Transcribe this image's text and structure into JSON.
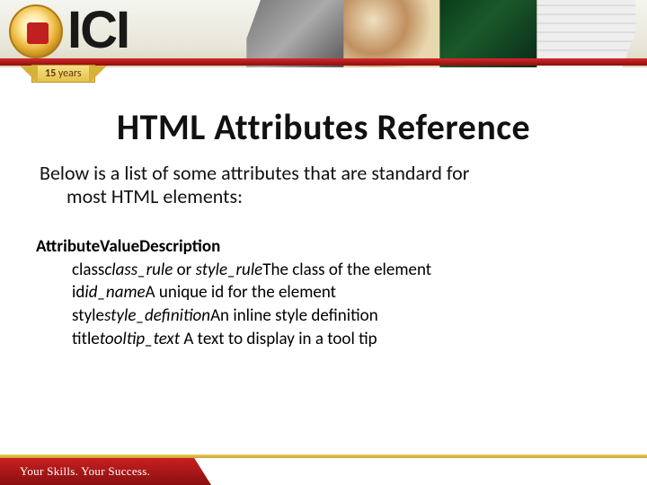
{
  "banner": {
    "logo_text": "ICI",
    "ribbon_number": "15",
    "ribbon_word": "years"
  },
  "title": "HTML Attributes Reference",
  "intro_line1": "Below is a list of some attributes that are standard for",
  "intro_line2": "most HTML elements:",
  "table": {
    "header_attr": "Attribute",
    "header_val": "Value",
    "header_desc": "Description",
    "rows": [
      {
        "attr": "class",
        "val": "class_rule",
        "val_sep": " or ",
        "val2": "style_rule",
        "desc": "The class of the element"
      },
      {
        "attr": "id",
        "val": "id_name",
        "val_sep": "",
        "val2": "",
        "desc": "A unique id for the element"
      },
      {
        "attr": "style",
        "val": "style_definition",
        "val_sep": "",
        "val2": "",
        "desc": "An inline style definition"
      },
      {
        "attr": "title",
        "val": "tooltip_text ",
        "val_sep": "",
        "val2": "",
        "desc": "A text to display in a tool tip"
      }
    ]
  },
  "footer": {
    "tagline": "Your Skills. Your Success."
  }
}
